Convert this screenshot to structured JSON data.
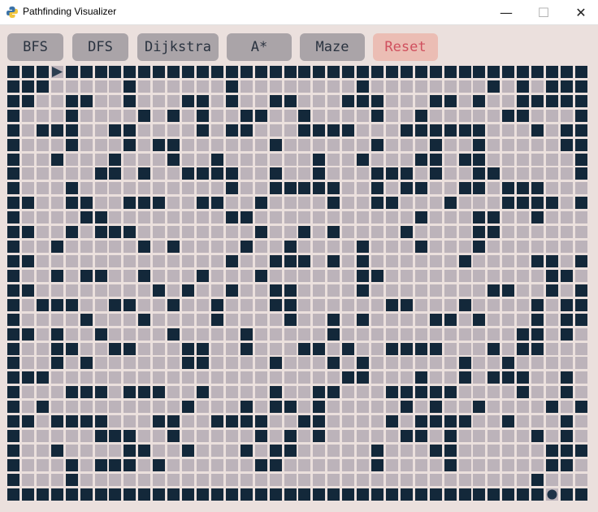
{
  "window": {
    "title": "Pathfinding Visualizer",
    "icon": "python-icon",
    "controls": {
      "minimize": "—",
      "maximize": "☐",
      "close": "✕"
    }
  },
  "toolbar": {
    "buttons": [
      "BFS",
      "DFS",
      "Dijkstra",
      "A*",
      "Maze",
      "Reset"
    ]
  },
  "colors": {
    "background": "#ebe0dd",
    "wall": "#13283a",
    "open": "#bcb3ba",
    "button": "#aaa4a8",
    "button_text": "#2a3340",
    "reset_button": "#ebbdb4",
    "reset_text": "#d0505e"
  },
  "grid": {
    "cols": 40,
    "rows": 30,
    "start": {
      "row": 0,
      "col": 3,
      "icon": "start-arrow-icon"
    },
    "end": {
      "row": 29,
      "col": 37,
      "icon": "end-dot-icon"
    },
    "cells": [
      "1110111111111111111111111111111111111111",
      "1110000010000001000000001000000001010111",
      "1100110010001101001100011100011010011111",
      "1000100001010100110010000100100000110001",
      "1011100110000101100011110001111110001011",
      "1000100010110000001000000100010010000011",
      "1001000100010010000001001000110110000001",
      "1000001101001111001001000111010011000001",
      "1000100000000001001111100101100110111000",
      "1100110011100110010000100110001000111101",
      "1000011000000001100000000000100011001000",
      "1100101110000000010010100001000011000000",
      "1001000001010000100100001000100010000000",
      "1100000000000001001110101000000100001101",
      "1001011001000100010000001100000000000110",
      "1100000000101001001100001000000001100101",
      "1011100110010010001100000011000100001011",
      "1000010001000010000100101000011010001011",
      "1101001000010000100000100000000000011010",
      "1001100110001100100011010011110001011000",
      "1001010000001100001000101000000100100000",
      "1110000000000000000000011000100101110010",
      "1000111011100100001001100011111000010010",
      "1010000000001000101101000001010010000101",
      "1101111000110011110011000010111100100010",
      "1000001110010000010101000001101000001010",
      "1001000011001000101100000100011000000111",
      "1000101110100000011000000100001000000110",
      "1000100000000000000000000000000000001000",
      "1111111111111111111111111111111111111111"
    ]
  }
}
